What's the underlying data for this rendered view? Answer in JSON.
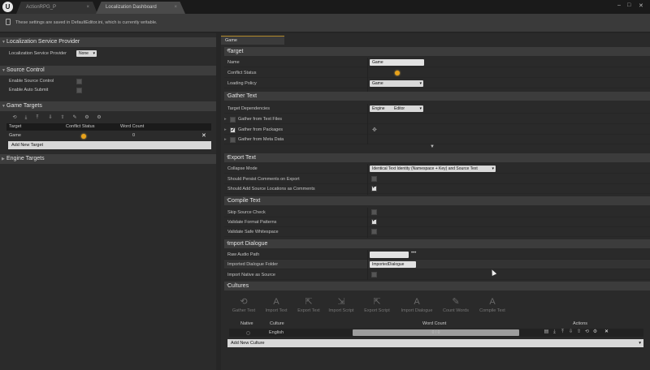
{
  "window": {
    "tabs": [
      {
        "label": "ActionRPG_P"
      },
      {
        "label": "Localization Dashboard"
      }
    ]
  },
  "infobar": {
    "text": "These settings are saved in DefaultEditor.ini, which is currently writable."
  },
  "left": {
    "provider": {
      "header": "Localization Service Provider",
      "label": "Localization Service Provider",
      "value": "None"
    },
    "source_control": {
      "header": "Source Control",
      "enable_source_control": "Enable Source Control",
      "enable_auto_submit": "Enable Auto Submit"
    },
    "game_targets": {
      "header": "Game Targets",
      "columns": [
        "Target",
        "Conflict Status",
        "Word Count"
      ],
      "rows": [
        {
          "target": "Game",
          "word_count": "0"
        }
      ],
      "add_button": "Add New Target"
    },
    "engine_targets": {
      "header": "Engine Targets"
    }
  },
  "right": {
    "tab": "Game",
    "target": {
      "header": "Target",
      "name_label": "Name",
      "name_value": "Game",
      "conflict_label": "Conflict Status",
      "loading_label": "Loading Policy",
      "loading_value": "Game"
    },
    "gather": {
      "header": "Gather Text",
      "deps_label": "Target Dependencies",
      "deps_value": "Engine",
      "deps_value2": "Editor",
      "text_files": "Gather from Text Files",
      "packages": "Gather from Packages",
      "meta_data": "Gather from Meta Data"
    },
    "export": {
      "header": "Export Text",
      "collapse_label": "Collapse Mode",
      "collapse_value": "Identical Text Identity (Namespace + Key) and Source Text",
      "persist_label": "Should Persist Comments on Export",
      "source_loc_label": "Should Add Source Locations as Comments"
    },
    "compile": {
      "header": "Compile Text",
      "skip_label": "Skip Source Check",
      "validate_format_label": "Validate Format Patterns",
      "validate_ws_label": "Validate Safe Whitespace"
    },
    "import_dialogue": {
      "header": "Import Dialogue",
      "raw_audio_label": "Raw Audio Path",
      "imported_folder_label": "Imported Dialogue Folder",
      "imported_folder_value": "ImportedDialogue",
      "native_label": "Import Native as Source"
    },
    "cultures": {
      "header": "Cultures",
      "toolbar": [
        "Gather Text",
        "Import Text",
        "Export Text",
        "Import Script",
        "Export Script",
        "Import Dialogue",
        "Count Words",
        "Compile Text"
      ],
      "columns": [
        "Native",
        "Culture",
        "Word Count",
        "Actions"
      ],
      "rows": [
        {
          "culture": "English",
          "word_count": "0 / 0"
        }
      ],
      "add_button": "Add New Culture"
    }
  }
}
